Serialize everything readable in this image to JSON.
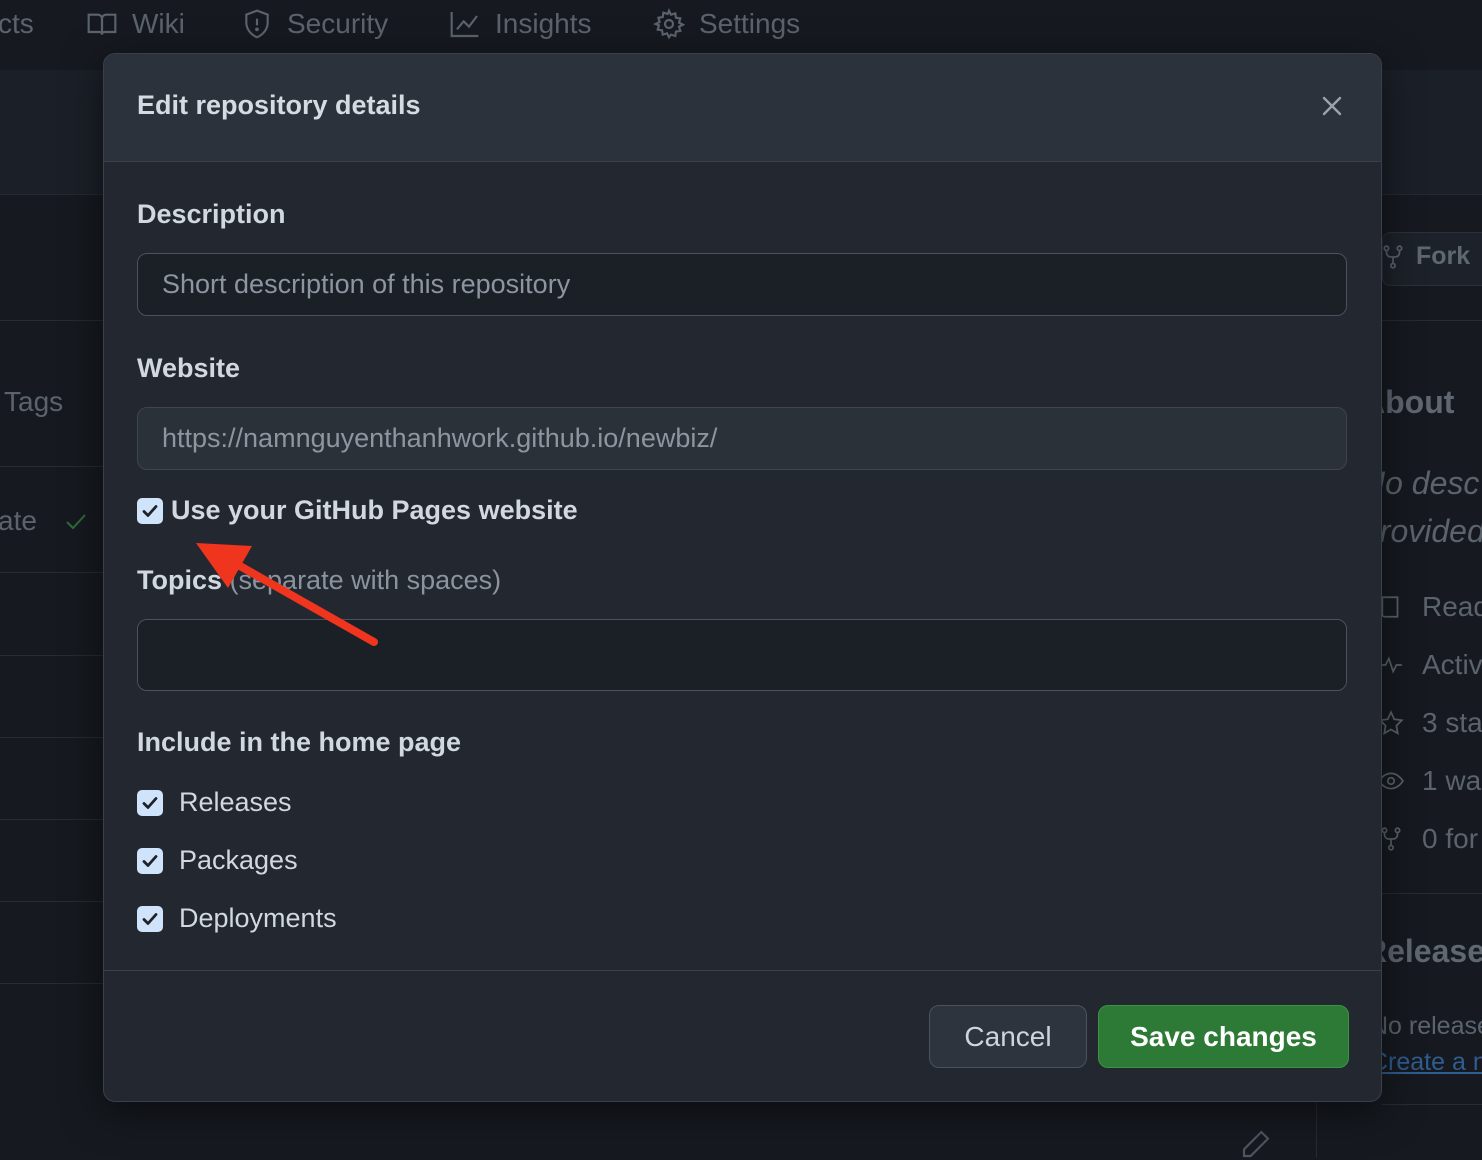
{
  "nav": {
    "tabs": [
      {
        "label": "cts",
        "icon": "projects-icon"
      },
      {
        "label": "Wiki",
        "icon": "book-icon"
      },
      {
        "label": "Security",
        "icon": "shield-icon"
      },
      {
        "label": "Insights",
        "icon": "graph-icon"
      },
      {
        "label": "Settings",
        "icon": "gear-icon"
      }
    ]
  },
  "background": {
    "left": {
      "tags": "Tags",
      "ate": "ate"
    },
    "right": {
      "fork": "Fork",
      "about": "About",
      "no_desc_1": "No desc",
      "no_desc_2": "provided",
      "readme": "Read",
      "activity": "Activ",
      "stars": "3 sta",
      "watching": "1 wa",
      "forks": "0 for",
      "releases": "Release",
      "no_releases": "No release",
      "create_release": "Create a n"
    }
  },
  "modal": {
    "title": "Edit repository details",
    "description": {
      "label": "Description",
      "placeholder": "Short description of this repository",
      "value": ""
    },
    "website": {
      "label": "Website",
      "value": "https://namnguyenthanhwork.github.io/newbiz/",
      "use_pages_label": "Use your GitHub Pages website",
      "use_pages_checked": true
    },
    "topics": {
      "label": "Topics",
      "hint": "(separate with spaces)",
      "value": ""
    },
    "home": {
      "heading": "Include in the home page",
      "options": [
        {
          "label": "Releases",
          "checked": true
        },
        {
          "label": "Packages",
          "checked": true
        },
        {
          "label": "Deployments",
          "checked": true
        }
      ]
    },
    "buttons": {
      "cancel": "Cancel",
      "save": "Save changes"
    }
  },
  "colors": {
    "accent_green": "#2c7a35",
    "checkbox": "#cfe3fb",
    "annotation_arrow": "#f0351f"
  }
}
